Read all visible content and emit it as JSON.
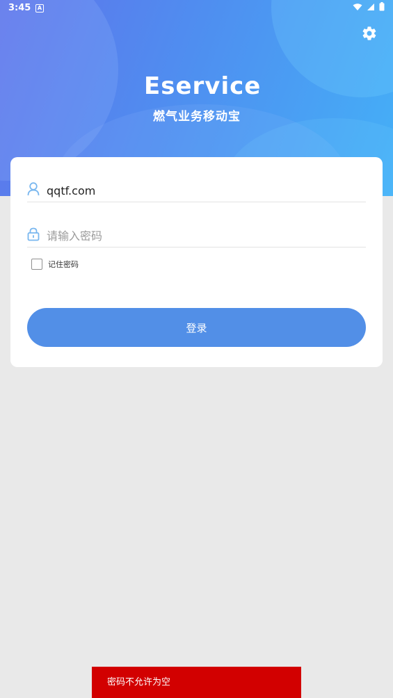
{
  "status_bar": {
    "time": "3:45",
    "notification_letter": "A"
  },
  "branding": {
    "logo_text": "Eservice",
    "subtitle": "燃气业务移动宝"
  },
  "login_form": {
    "username_value": "qqtf.com",
    "password_placeholder": "请输入密码",
    "remember_label": "记住密码",
    "login_label": "登录"
  },
  "toast": {
    "message": "密码不允许为空"
  },
  "colors": {
    "primary": "#528fe7",
    "toast_bg": "#d20000",
    "icon_blue": "#79b7ef"
  }
}
